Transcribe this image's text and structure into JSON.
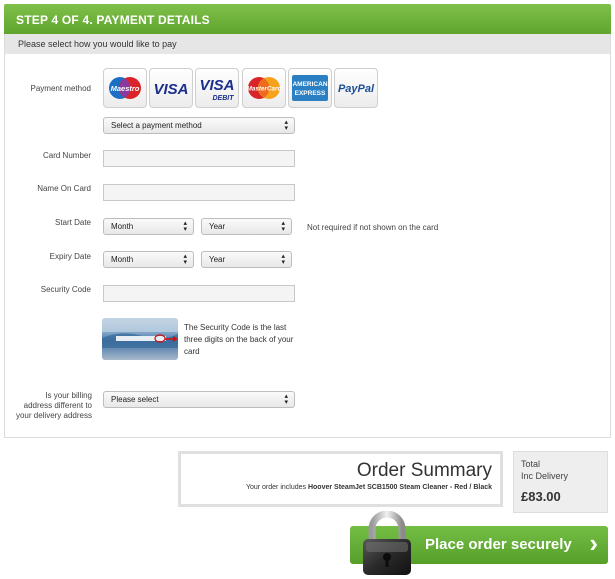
{
  "header": {
    "title": "STEP 4 OF 4. PAYMENT DETAILS"
  },
  "subheader": {
    "text": "Please select how you would like to pay"
  },
  "payment_method": {
    "label": "Payment method",
    "cards": [
      {
        "name": "maestro-logo",
        "text": "Maestro"
      },
      {
        "name": "visa-logo",
        "text": "VISA"
      },
      {
        "name": "visa-debit-logo",
        "text": "VISA",
        "sub": "DEBIT"
      },
      {
        "name": "mastercard-logo",
        "text": "MasterCard"
      },
      {
        "name": "amex-logo",
        "text": "AMERICAN",
        "sub": "EXPRESS"
      },
      {
        "name": "paypal-logo",
        "text": "PayPal"
      }
    ],
    "select_value": "Select a payment method"
  },
  "card_number": {
    "label": "Card Number",
    "value": ""
  },
  "name_on_card": {
    "label": "Name On Card",
    "value": ""
  },
  "start_date": {
    "label": "Start Date",
    "month": "Month",
    "year": "Year",
    "note": "Not required if not shown on the card"
  },
  "expiry_date": {
    "label": "Expiry Date",
    "month": "Month",
    "year": "Year"
  },
  "security_code": {
    "label": "Security Code",
    "value": "",
    "help": "The Security Code is the last three digits on the back of your card"
  },
  "billing": {
    "label_lines": [
      "Is your billing",
      "address different to",
      "your delivery address"
    ],
    "select_value": "Please select"
  },
  "summary": {
    "title": "Order Summary",
    "prefix": "Your order includes",
    "product": "Hoover SteamJet SCB1500 Steam Cleaner - Red / Black"
  },
  "total": {
    "label_line1": "Total",
    "label_line2": "Inc Delivery",
    "price": "£83.00"
  },
  "place_order": {
    "label": "Place order securely"
  },
  "colors": {
    "brand_green": "#6ab23a",
    "subheader_bg": "#e6e6e6"
  }
}
